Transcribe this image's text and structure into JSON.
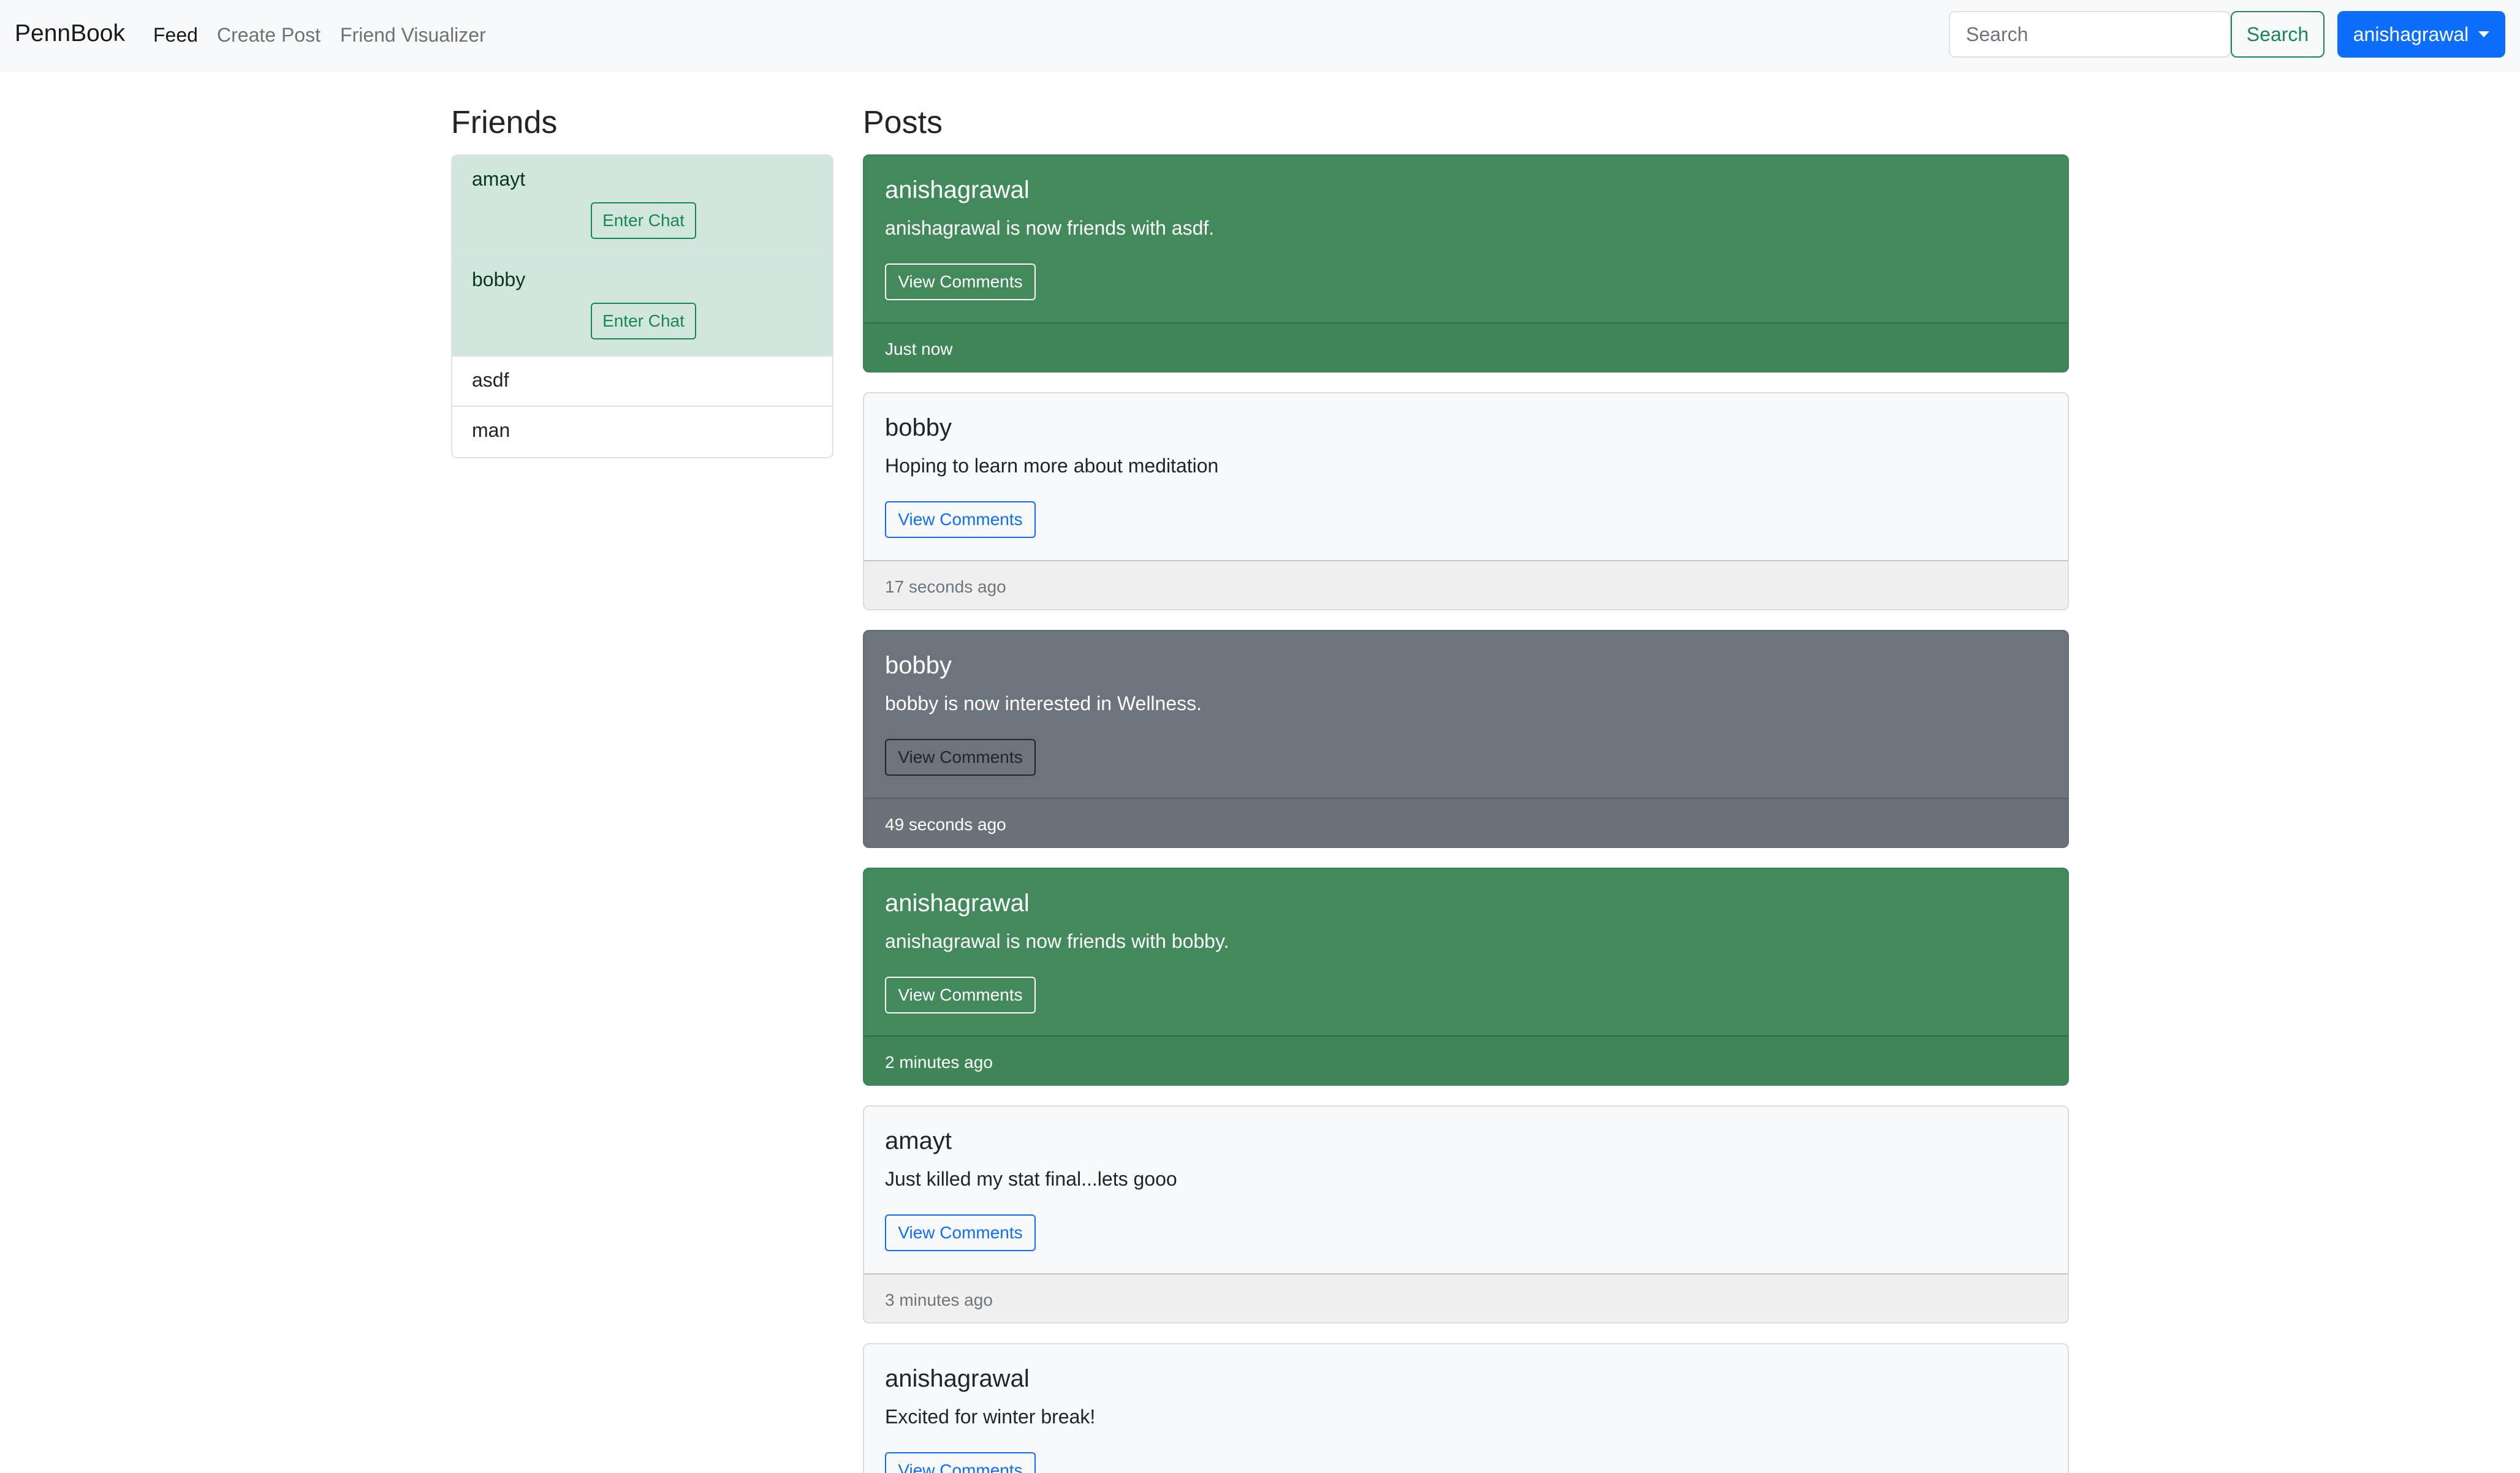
{
  "navbar": {
    "brand": "PennBook",
    "links": [
      "Feed",
      "Create Post",
      "Friend Visualizer"
    ],
    "search_placeholder": "Search",
    "search_button": "Search",
    "user": "anishagrawal"
  },
  "friends": {
    "title": "Friends",
    "items": [
      {
        "name": "amayt",
        "chat_label": "Enter Chat"
      },
      {
        "name": "bobby",
        "chat_label": "Enter Chat"
      },
      {
        "name": "asdf"
      },
      {
        "name": "man"
      }
    ]
  },
  "posts": {
    "title": "Posts",
    "items": [
      {
        "author": "anishagrawal",
        "text": "anishagrawal is now friends with asdf.",
        "button": "View Comments",
        "time": "Just now"
      },
      {
        "author": "bobby",
        "text": "Hoping to learn more about meditation",
        "button": "View Comments",
        "time": "17 seconds ago"
      },
      {
        "author": "bobby",
        "text": "bobby is now interested in Wellness.",
        "button": "View Comments",
        "time": "49 seconds ago"
      },
      {
        "author": "anishagrawal",
        "text": "anishagrawal is now friends with bobby.",
        "button": "View Comments",
        "time": "2 minutes ago"
      },
      {
        "author": "amayt",
        "text": "Just killed my stat final...lets gooo",
        "button": "View Comments",
        "time": "3 minutes ago"
      },
      {
        "author": "anishagrawal",
        "text": "Excited for winter break!",
        "button": "View Comments",
        "time": ""
      }
    ]
  },
  "colors": {
    "primary": "#0d6efd",
    "success": "#198754",
    "success_card": "#428a5c",
    "secondary_card": "#6c757d",
    "online_friend": "#d1e7dd"
  }
}
